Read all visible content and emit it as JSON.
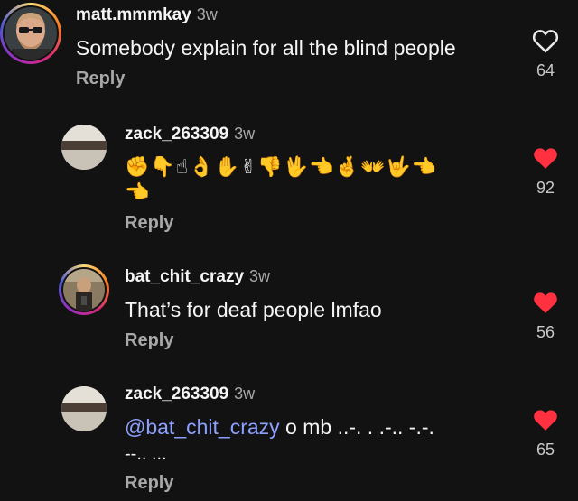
{
  "comments": [
    {
      "username": "matt.mmmkay",
      "time": "3w",
      "text": "Somebody explain for all the blind people",
      "reply_label": "Reply",
      "likes": "64",
      "liked": false,
      "avatar_ring": true
    },
    {
      "username": "zack_263309",
      "time": "3w",
      "text_line1": "✊👇☝👌✋✌👎🖖👈🤞👐🤟👈",
      "text_line2": "👈",
      "reply_label": "Reply",
      "likes": "92",
      "liked": true,
      "avatar_ring": false
    },
    {
      "username": "bat_chit_crazy",
      "time": "3w",
      "text": "That’s for deaf people lmfao",
      "reply_label": "Reply",
      "likes": "56",
      "liked": true,
      "avatar_ring": true
    },
    {
      "username": "zack_263309",
      "time": "3w",
      "mention": "@bat_chit_crazy",
      "text_rest": " o mb ..-. . .-.. -.-.",
      "text_line2": "--.. ...",
      "reply_label": "Reply",
      "likes": "65",
      "liked": true,
      "avatar_ring": false
    }
  ],
  "colors": {
    "background": "#121212",
    "like_red": "#ff3040",
    "mention": "#8ea0ff",
    "secondary_text": "#a8a8a8"
  },
  "icons": {
    "heart_outline": "heart-outline-icon",
    "heart_filled": "heart-filled-icon"
  }
}
